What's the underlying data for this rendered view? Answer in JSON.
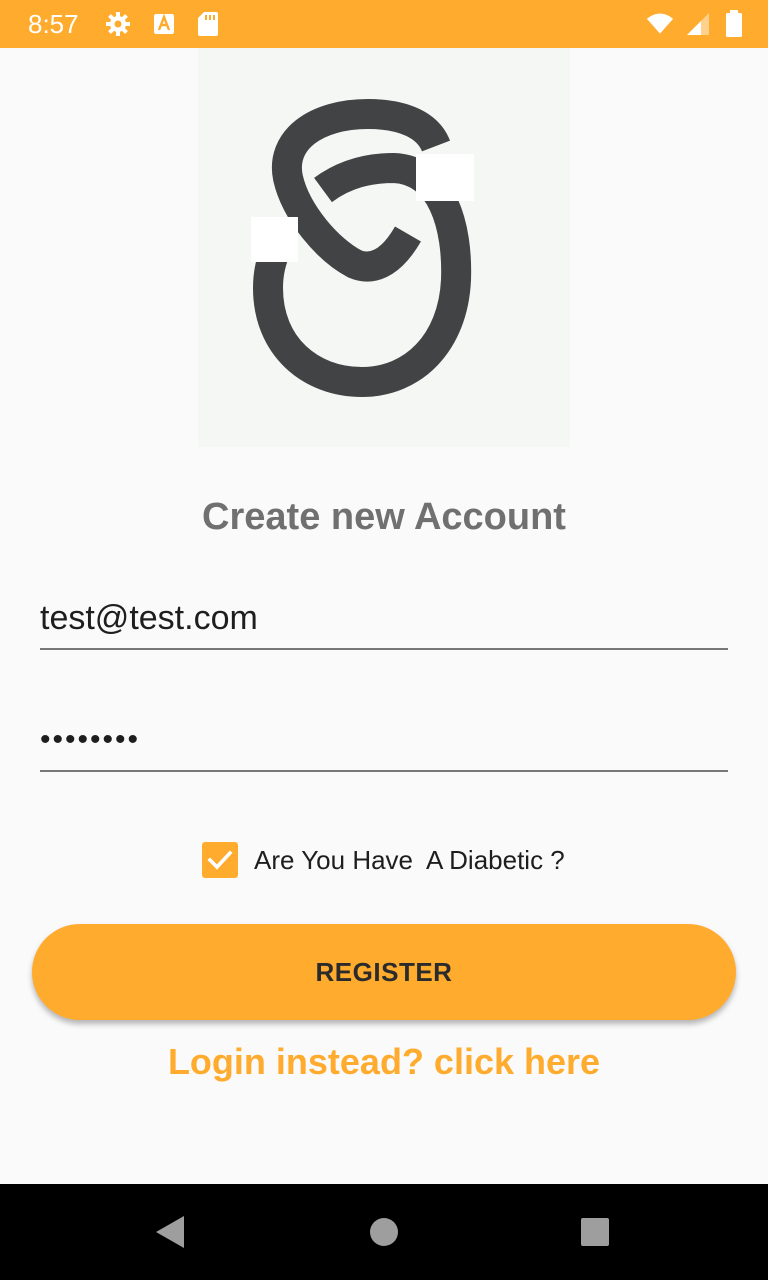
{
  "status_bar": {
    "time": "8:57",
    "icons": [
      "gear-icon",
      "font-a-icon",
      "sd-card-icon",
      "wifi-icon",
      "cell-signal-icon",
      "battery-icon"
    ],
    "background_color": "#ffab2e"
  },
  "logo": {
    "icon": "app-logo-s-icon",
    "color": "#424345"
  },
  "form": {
    "title": "Create new Account",
    "email_value": "test@test.com",
    "password_value": "••••••••",
    "diabetic_checkbox": {
      "label": "Are You Have  A Diabetic ?",
      "checked": true
    },
    "register_label": "REGISTER",
    "login_link": "Login instead? click here"
  },
  "colors": {
    "accent": "#ffab2e",
    "title": "#707070",
    "text": "#1e1e1e"
  },
  "nav_bar": {
    "icons": [
      "back-icon",
      "home-icon",
      "recents-icon"
    ]
  }
}
